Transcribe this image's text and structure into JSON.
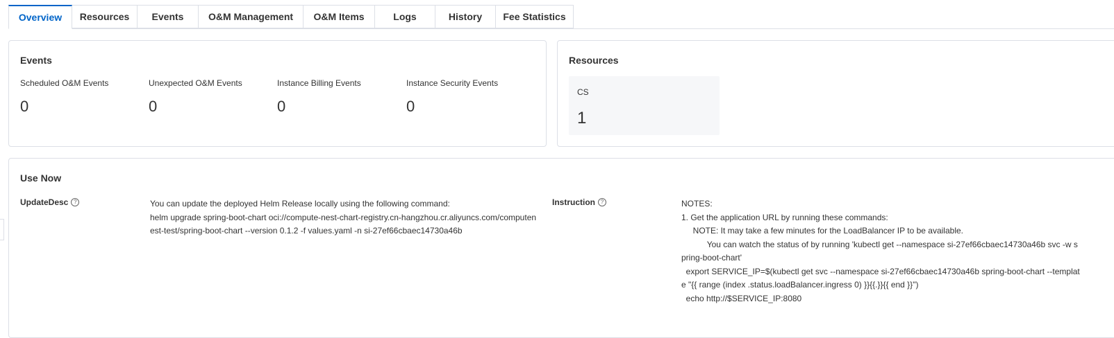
{
  "tabs": [
    {
      "label": "Overview",
      "active": true
    },
    {
      "label": "Resources"
    },
    {
      "label": "Events"
    },
    {
      "label": "O&M Management"
    },
    {
      "label": "O&M Items"
    },
    {
      "label": "Logs"
    },
    {
      "label": "History"
    },
    {
      "label": "Fee Statistics"
    }
  ],
  "events": {
    "title": "Events",
    "stats": [
      {
        "label": "Scheduled O&M Events",
        "value": "0"
      },
      {
        "label": "Unexpected O&M Events",
        "value": "0"
      },
      {
        "label": "Instance Billing Events",
        "value": "0"
      },
      {
        "label": "Instance Security Events",
        "value": "0"
      }
    ]
  },
  "resources": {
    "title": "Resources",
    "items": [
      {
        "label": "CS",
        "value": "1"
      }
    ]
  },
  "use_now": {
    "title": "Use Now",
    "update_desc": {
      "label": "UpdateDesc",
      "value": "You can update the deployed Helm Release locally using the following command:\nhelm upgrade spring-boot-chart oci://compute-nest-chart-registry.cn-hangzhou.cr.aliyuncs.com/computen\nest-test/spring-boot-chart --version 0.1.2 -f values.yaml -n si-27ef66cbaec14730a46b"
    },
    "instruction": {
      "label": "Instruction",
      "value": "NOTES:\n1. Get the application URL by running these commands:\n     NOTE: It may take a few minutes for the LoadBalancer IP to be available.\n           You can watch the status of by running 'kubectl get --namespace si-27ef66cbaec14730a46b svc -w s\npring-boot-chart'\n  export SERVICE_IP=$(kubectl get svc --namespace si-27ef66cbaec14730a46b spring-boot-chart --templat\ne \"{{ range (index .status.loadBalancer.ingress 0) }}{{.}}{{ end }}\")\n  echo http://$SERVICE_IP:8080"
    }
  },
  "icons": {
    "help": "question-circle-icon"
  },
  "colors": {
    "accent": "#0064c8",
    "border": "#dcdfe6",
    "stat_box_bg": "#f6f7f9"
  }
}
